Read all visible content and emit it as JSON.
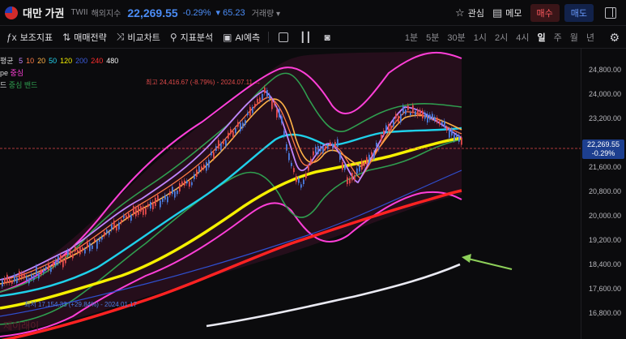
{
  "header": {
    "symbol_name": "대만 가권",
    "symbol_code": "TWII",
    "symbol_type": "해외지수",
    "price": "22,269.55",
    "change_pct": "-0.29%",
    "change_abs": "▾ 65.23",
    "volume_label": "거래량",
    "volume_caret": "▾",
    "watch_label": "관심",
    "memo_label": "메모",
    "buy_label": "매수",
    "sell_label": "매도",
    "colors": {
      "price": "#4b8cf5",
      "buy": "#ff5a5f",
      "sell": "#6a9cff"
    }
  },
  "toolbar": {
    "indicator_label": "보조지표",
    "strategy_label": "매매전략",
    "compare_label": "비교차트",
    "analysis_label": "지표분석",
    "ai_label": "AI예측",
    "timeframes": [
      "1분",
      "5분",
      "30분",
      "1시",
      "2시",
      "4시",
      "일",
      "주",
      "월",
      "년"
    ],
    "active_timeframe": "일"
  },
  "legend": {
    "ma_prefix": "평균",
    "ma_periods": [
      {
        "label": "5",
        "color": "#c084fc"
      },
      {
        "label": "10",
        "color": "#ff7a45"
      },
      {
        "label": "20",
        "color": "#ffb347"
      },
      {
        "label": "50",
        "color": "#22d3ee"
      },
      {
        "label": "120",
        "color": "#f4f000"
      },
      {
        "label": "200",
        "color": "#3b5bdb"
      },
      {
        "label": "240",
        "color": "#ff2d2d"
      },
      {
        "label": "480",
        "color": "#f5f5f5"
      }
    ],
    "line2_prefix": "pe",
    "line2_label": "중심",
    "line3_prefix": "드",
    "line3_label": "중심 밴드"
  },
  "chart": {
    "high_annotation": "최고 24,416.67 (-8.79%) - 2024.07.11 →",
    "low_annotation": "최저 17,154.33 (+29.84%) - 2024.01.17",
    "watermark": "제이래이",
    "current_price_tag": "22,269.55",
    "current_change_tag": "-0.29%"
  },
  "axis": {
    "ticks": [
      "24,800.00",
      "24,000.00",
      "23,200.00",
      "22,400.00",
      "21,600.00",
      "20,800.00",
      "20,000.00",
      "19,200.00",
      "18,400.00",
      "17,600.00",
      "16,800.00"
    ]
  }
}
